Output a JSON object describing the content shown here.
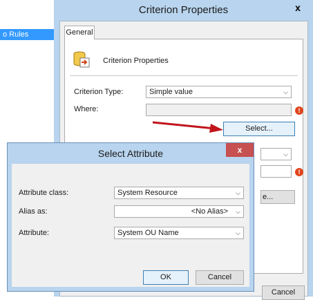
{
  "background": {
    "left_pane_item": "o Rules"
  },
  "criterion_window": {
    "title": "Criterion Properties",
    "close_glyph": "x",
    "tab": "General",
    "heading": "Criterion Properties",
    "type_label": "Criterion Type:",
    "type_value": "Simple value",
    "where_label": "Where:",
    "where_value": "",
    "select_button": "Select...",
    "hidden_field_button_tail": "e...",
    "cancel_button": "Cancel",
    "error_glyph": "!"
  },
  "select_attribute_dialog": {
    "title": "Select Attribute",
    "close_glyph": "x",
    "attribute_class_label": "Attribute class:",
    "attribute_class_value": "System Resource",
    "alias_label": "Alias as:",
    "alias_value": "<No Alias>",
    "attribute_label": "Attribute:",
    "attribute_value": "System OU Name",
    "ok_button": "OK",
    "cancel_button": "Cancel"
  },
  "colors": {
    "title_bar": "#b8d4ee",
    "selection": "#3399ff",
    "arrow": "#c0151b",
    "error": "#e0451c"
  }
}
